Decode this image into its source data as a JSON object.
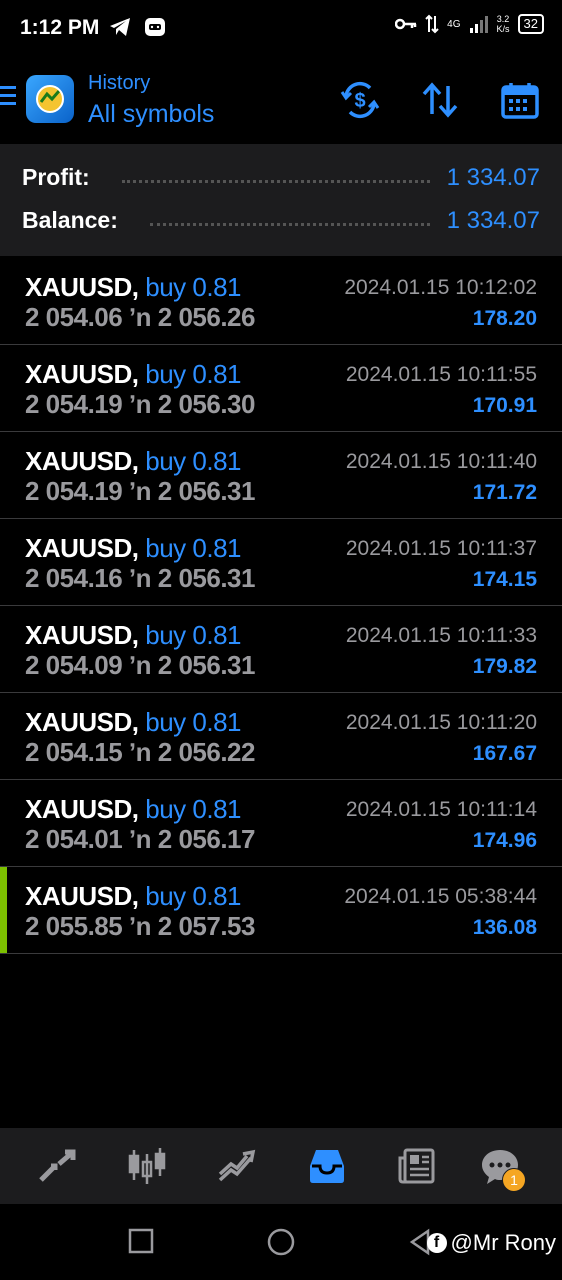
{
  "status_bar": {
    "time": "1:12 PM",
    "network": "4G",
    "speed_value": "3.2",
    "speed_unit": "K/s",
    "battery": "32",
    "icons_left": [
      "telegram-icon",
      "game-icon"
    ],
    "icons_right": [
      "key-icon",
      "data-transfer-icon",
      "signal-icon",
      "battery-icon"
    ]
  },
  "header": {
    "subtitle": "History",
    "title": "All symbols",
    "icons": [
      "menu-icon",
      "app-logo-icon",
      "currency-exchange-icon",
      "sort-icon",
      "calendar-icon"
    ]
  },
  "summary": {
    "profit_label": "Profit:",
    "profit_value": "1 334.07",
    "balance_label": "Balance:",
    "balance_value": "1 334.07"
  },
  "deals": [
    {
      "symbol": "XAUUSD,",
      "type": "buy 0.81",
      "prices": "2 054.06 ʼn  2 056.26",
      "time": "2024.01.15 10:12:02",
      "profit": "178.20"
    },
    {
      "symbol": "XAUUSD,",
      "type": "buy 0.81",
      "prices": "2 054.19 ʼn  2 056.30",
      "time": "2024.01.15 10:11:55",
      "profit": "170.91"
    },
    {
      "symbol": "XAUUSD,",
      "type": "buy 0.81",
      "prices": "2 054.19 ʼn  2 056.31",
      "time": "2024.01.15 10:11:40",
      "profit": "171.72"
    },
    {
      "symbol": "XAUUSD,",
      "type": "buy 0.81",
      "prices": "2 054.16 ʼn  2 056.31",
      "time": "2024.01.15 10:11:37",
      "profit": "174.15"
    },
    {
      "symbol": "XAUUSD,",
      "type": "buy 0.81",
      "prices": "2 054.09 ʼn  2 056.31",
      "time": "2024.01.15 10:11:33",
      "profit": "179.82"
    },
    {
      "symbol": "XAUUSD,",
      "type": "buy 0.81",
      "prices": "2 054.15 ʼn  2 056.22",
      "time": "2024.01.15 10:11:20",
      "profit": "167.67"
    },
    {
      "symbol": "XAUUSD,",
      "type": "buy 0.81",
      "prices": "2 054.01 ʼn  2 056.17",
      "time": "2024.01.15 10:11:14",
      "profit": "174.96"
    },
    {
      "symbol": "XAUUSD,",
      "type": "buy 0.81",
      "prices": "2 055.85 ʼn  2 057.53",
      "time": "2024.01.15 05:38:44",
      "profit": "136.08"
    }
  ],
  "bottom_nav": {
    "items": [
      "quotes-icon",
      "chart-icon",
      "trade-icon",
      "history-icon",
      "news-icon",
      "chat-icon"
    ],
    "active": "history-icon",
    "chat_badge": "1"
  },
  "system_nav": {
    "watermark": "@Mr Rony",
    "watermark_icon": "f"
  },
  "colors": {
    "accent": "#2e8fff",
    "background": "#000000",
    "panel": "#1c1c1e",
    "muted_text": "#9a9a9e",
    "marker": "#7cc000",
    "badge": "#f5a623"
  }
}
